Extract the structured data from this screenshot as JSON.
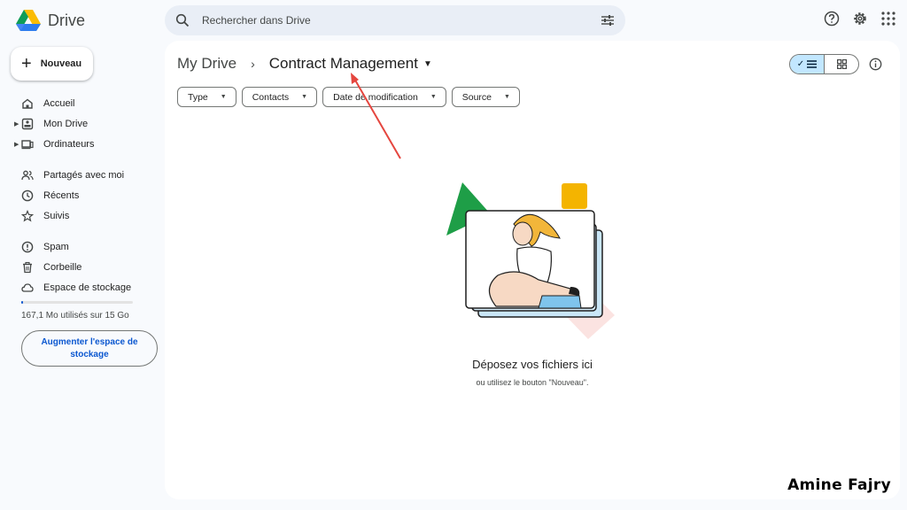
{
  "app": {
    "name": "Drive"
  },
  "search": {
    "placeholder": "Rechercher dans Drive"
  },
  "sidebar": {
    "new_label": "Nouveau",
    "items": [
      {
        "label": "Accueil",
        "icon": "home-icon"
      },
      {
        "label": "Mon Drive",
        "icon": "my-drive-icon"
      },
      {
        "label": "Ordinateurs",
        "icon": "computer-icon"
      },
      {
        "label": "Partagés avec moi",
        "icon": "people-icon"
      },
      {
        "label": "Récents",
        "icon": "clock-icon"
      },
      {
        "label": "Suivis",
        "icon": "star-icon"
      },
      {
        "label": "Spam",
        "icon": "spam-icon"
      },
      {
        "label": "Corbeille",
        "icon": "trash-icon"
      },
      {
        "label": "Espace de stockage",
        "icon": "cloud-icon"
      }
    ],
    "storage_text": "167,1 Mo utilisés sur 15 Go",
    "storage_used_fraction": 0.011,
    "upgrade_label": "Augmenter l'espace de stockage"
  },
  "main": {
    "breadcrumb_root": "My Drive",
    "breadcrumb_current": "Contract Management",
    "filters": [
      "Type",
      "Contacts",
      "Date de modification",
      "Source"
    ],
    "empty_title": "Déposez vos fichiers ici",
    "empty_subtitle": "ou utilisez le bouton \"Nouveau\"."
  },
  "watermark": "Amine Fajry",
  "colors": {
    "accent": "#0b57d0",
    "selected_toggle": "#c2e7ff",
    "annotation_arrow": "#e5463f"
  }
}
